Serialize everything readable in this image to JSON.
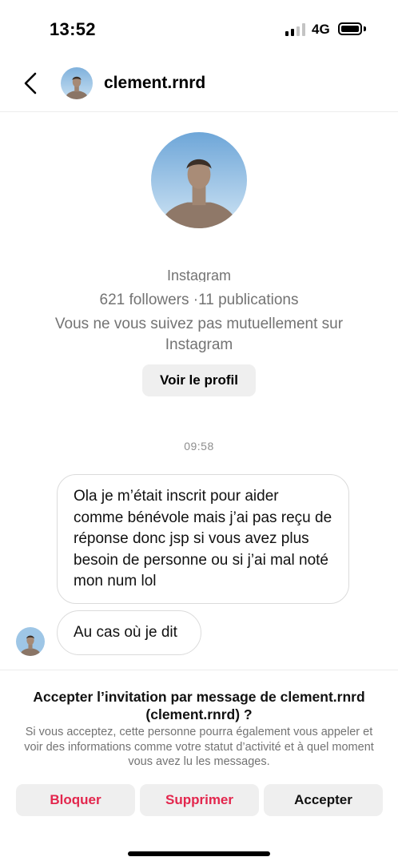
{
  "status_bar": {
    "time": "13:52",
    "network": "4G",
    "icons": [
      "signal-icon",
      "battery-icon"
    ]
  },
  "header": {
    "username": "clement.rnrd",
    "back_icon": "chevron-left-icon",
    "avatar_icon": "avatar"
  },
  "profile": {
    "subtitle": "Instagram",
    "stats": "621 followers ·11 publications",
    "mutual": "Vous ne vous suivez pas mutuellement sur Instagram",
    "view_profile_label": "Voir le profil"
  },
  "conversation": {
    "timestamp": "09:58",
    "messages": [
      {
        "text": "Ola je m’était inscrit pour aider comme bénévole mais j’ai pas reçu de réponse donc jsp si vous avez plus besoin de personne ou si j’ai mal noté mon num lol"
      },
      {
        "text": "Au cas où je dit"
      }
    ]
  },
  "invite": {
    "title": "Accepter l’invitation par message de clement.rnrd (clement.rnrd) ?",
    "description": "Si vous acceptez, cette personne pourra également vous appeler et voir des informations comme votre statut d’activité et à quel moment vous avez lu les messages.",
    "block_label": "Bloquer",
    "delete_label": "Supprimer",
    "accept_label": "Accepter"
  },
  "colors": {
    "destructive": "#e3264d",
    "secondary_text": "#737373",
    "button_bg": "#efefef"
  }
}
